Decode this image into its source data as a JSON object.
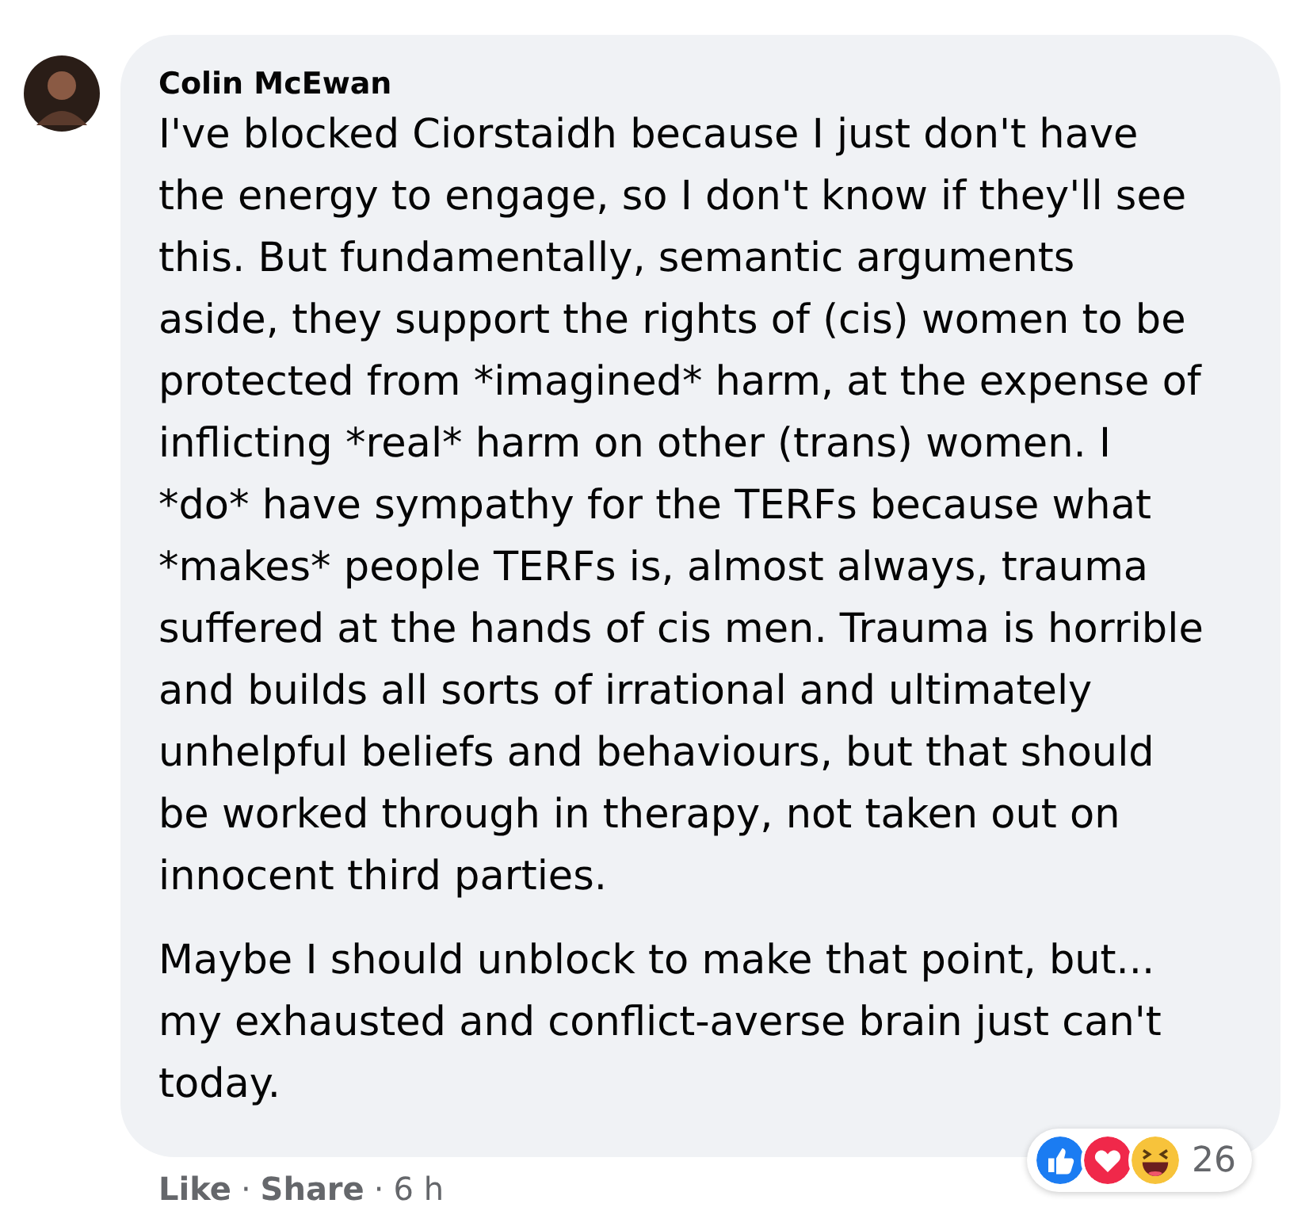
{
  "comment": {
    "author": "Colin McEwan",
    "paragraphs": [
      "I've blocked Ciorstaidh because I just don't have the energy to engage, so I don't know if they'll see this. But fundamentally, semantic arguments aside, they support the rights of (cis) women to be protected from *imagined* harm, at the expense of inflicting *real* harm on other (trans) women. I *do* have sympathy for the TERFs because what *makes* people TERFs is, almost always, trauma suffered at the hands of cis men. Trauma is horrible and builds all sorts of irrational and ultimately unhelpful beliefs and behaviours, but that should be worked through in therapy, not taken out on innocent third parties.",
      "Maybe I should unblock to make that point, but... my exhausted and conflict-averse brain just can't today."
    ],
    "reactions": {
      "kinds": [
        {
          "kind": "like"
        },
        {
          "kind": "love"
        },
        {
          "kind": "haha"
        }
      ],
      "count": "26"
    },
    "actions": [
      "Like",
      "Share"
    ],
    "separator": "·",
    "time": "6 h"
  }
}
